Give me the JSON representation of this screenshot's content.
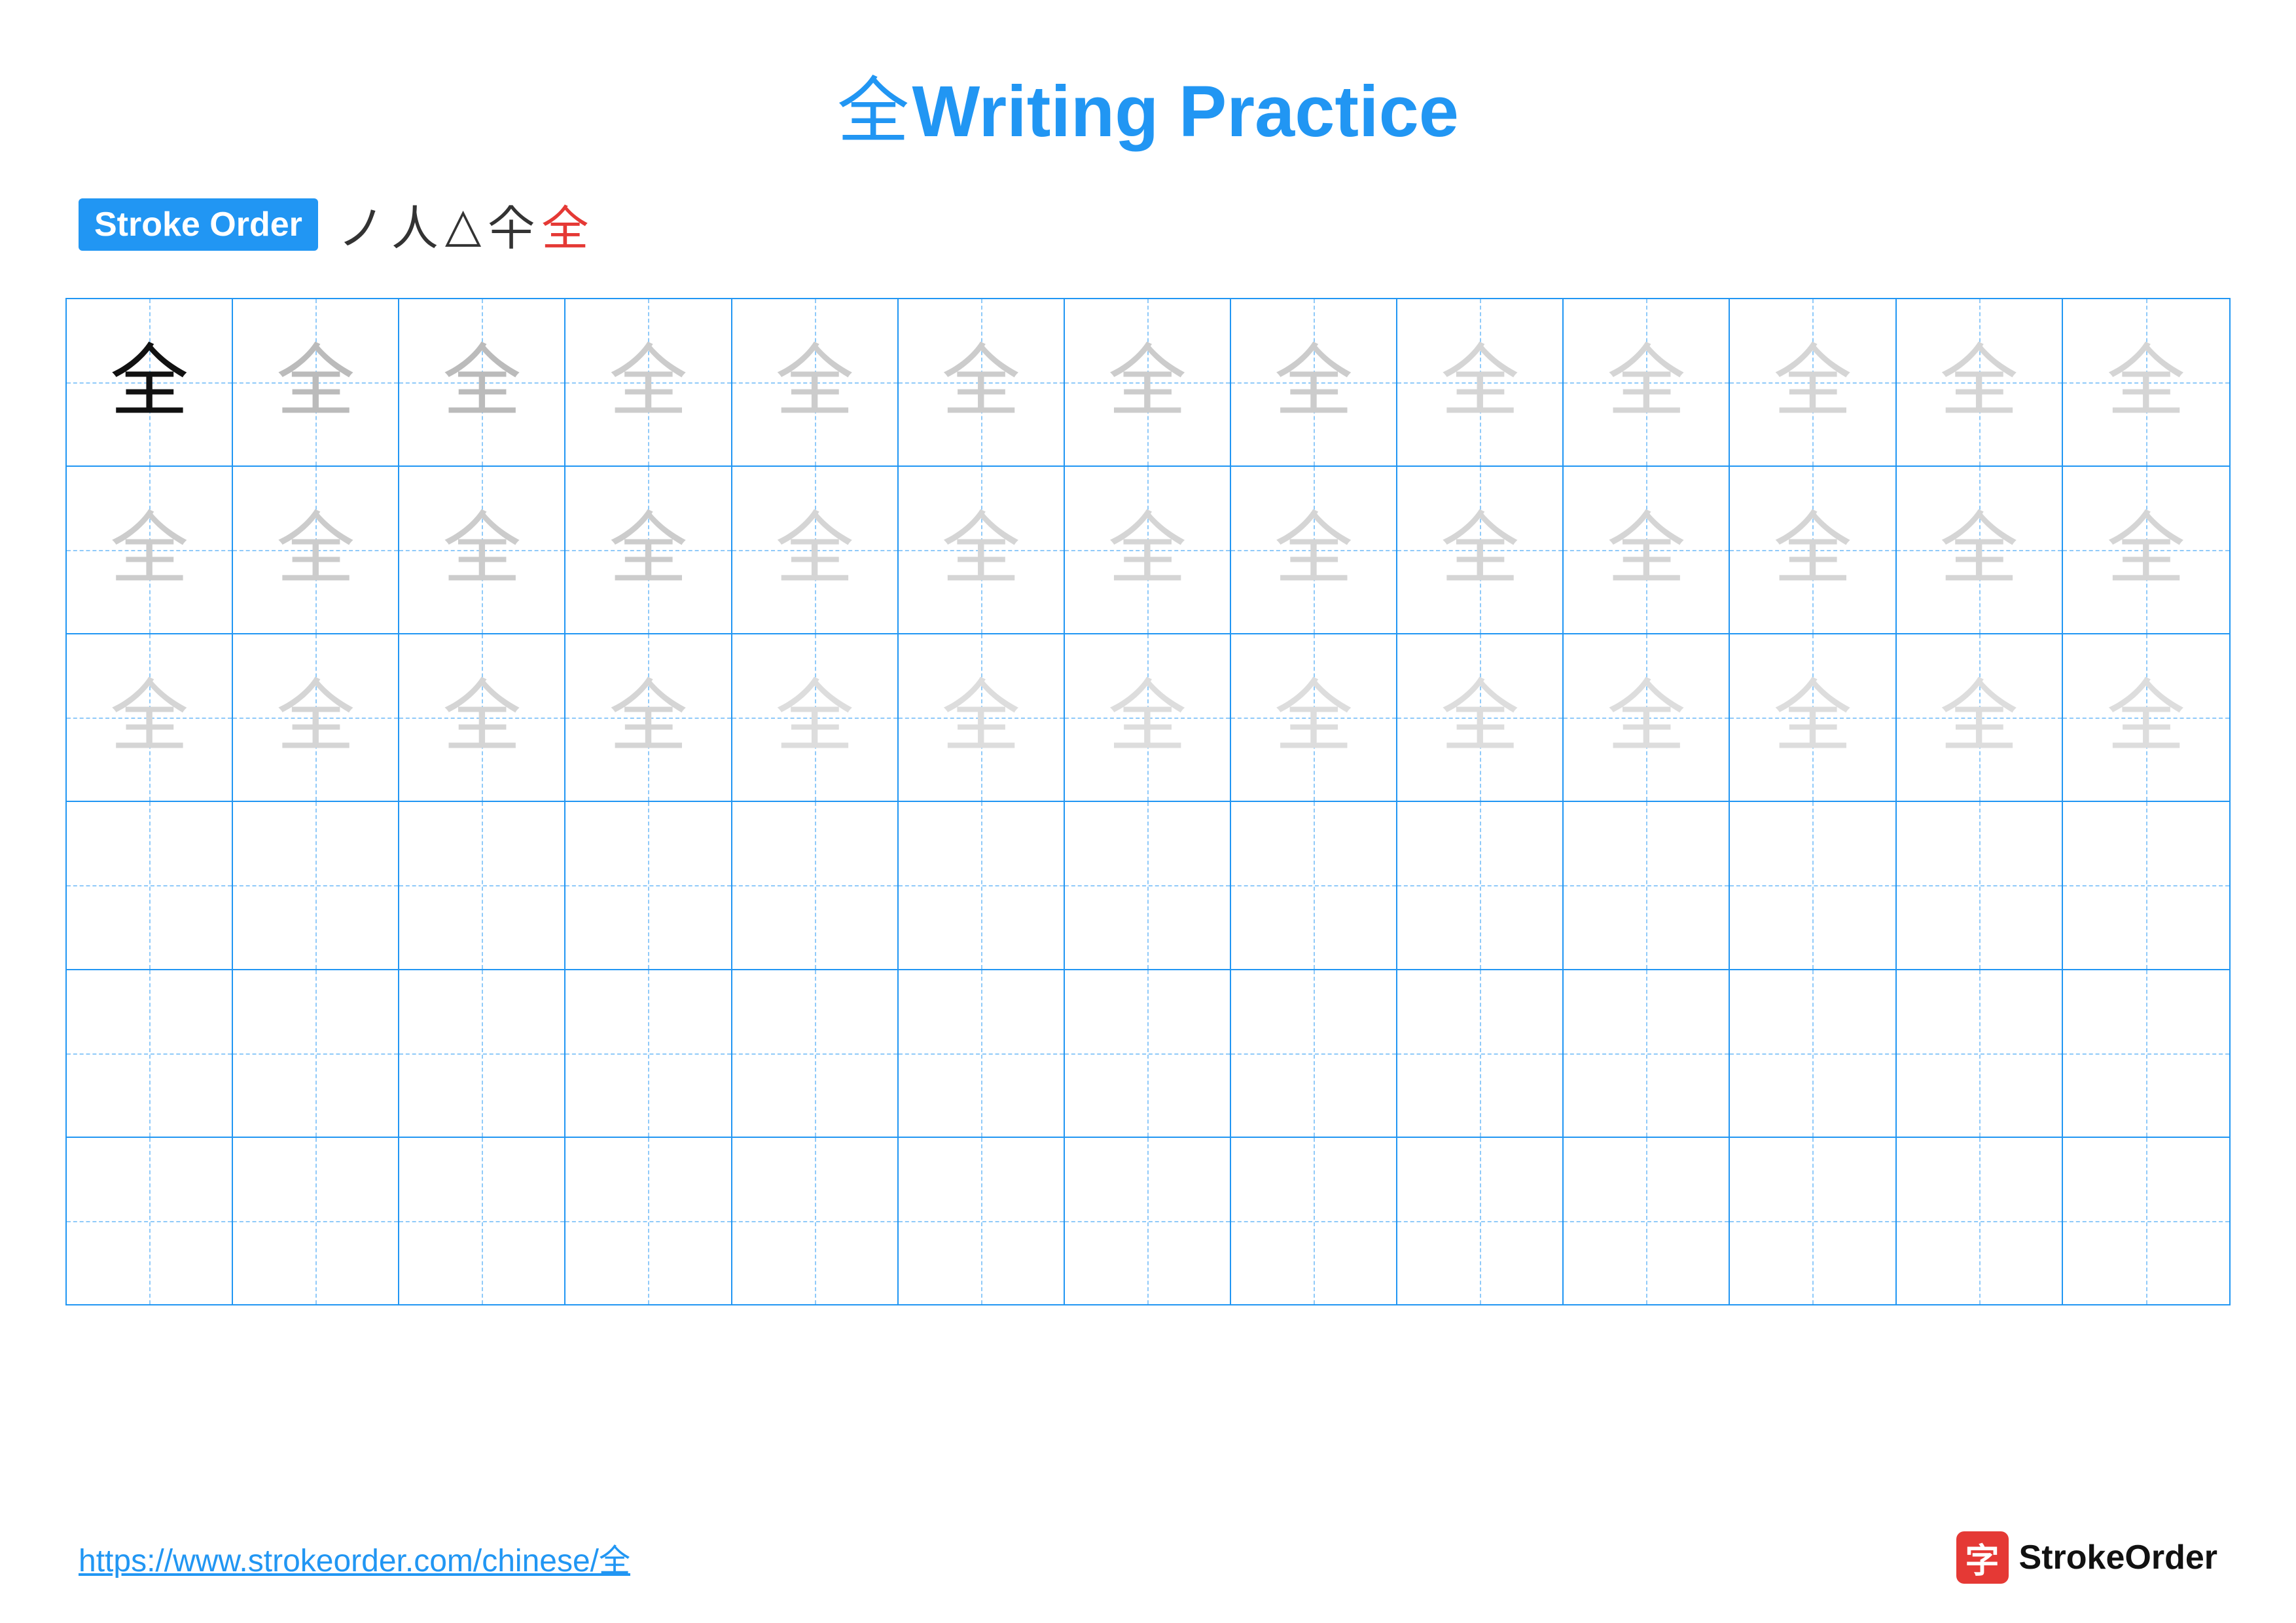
{
  "title": {
    "char": "全",
    "text": "Writing Practice"
  },
  "stroke_order": {
    "badge_label": "Stroke Order",
    "strokes": [
      "ノ",
      "人",
      "△",
      "仐",
      "全"
    ]
  },
  "grid": {
    "rows": 6,
    "cols": 13,
    "rows_data": [
      {
        "cells": [
          {
            "char": "全",
            "shade": "dark"
          },
          {
            "char": "全",
            "shade": "gray1"
          },
          {
            "char": "全",
            "shade": "gray1"
          },
          {
            "char": "全",
            "shade": "gray2"
          },
          {
            "char": "全",
            "shade": "gray2"
          },
          {
            "char": "全",
            "shade": "gray2"
          },
          {
            "char": "全",
            "shade": "gray2"
          },
          {
            "char": "全",
            "shade": "gray2"
          },
          {
            "char": "全",
            "shade": "gray3"
          },
          {
            "char": "全",
            "shade": "gray3"
          },
          {
            "char": "全",
            "shade": "gray3"
          },
          {
            "char": "全",
            "shade": "gray3"
          },
          {
            "char": "全",
            "shade": "gray3"
          }
        ]
      },
      {
        "cells": [
          {
            "char": "全",
            "shade": "gray2"
          },
          {
            "char": "全",
            "shade": "gray2"
          },
          {
            "char": "全",
            "shade": "gray2"
          },
          {
            "char": "全",
            "shade": "gray2"
          },
          {
            "char": "全",
            "shade": "gray3"
          },
          {
            "char": "全",
            "shade": "gray3"
          },
          {
            "char": "全",
            "shade": "gray3"
          },
          {
            "char": "全",
            "shade": "gray3"
          },
          {
            "char": "全",
            "shade": "gray3"
          },
          {
            "char": "全",
            "shade": "gray3"
          },
          {
            "char": "全",
            "shade": "gray3"
          },
          {
            "char": "全",
            "shade": "gray3"
          },
          {
            "char": "全",
            "shade": "gray3"
          }
        ]
      },
      {
        "cells": [
          {
            "char": "全",
            "shade": "gray3"
          },
          {
            "char": "全",
            "shade": "gray3"
          },
          {
            "char": "全",
            "shade": "gray3"
          },
          {
            "char": "全",
            "shade": "gray3"
          },
          {
            "char": "全",
            "shade": "gray3"
          },
          {
            "char": "全",
            "shade": "gray3"
          },
          {
            "char": "全",
            "shade": "gray3"
          },
          {
            "char": "全",
            "shade": "gray3"
          },
          {
            "char": "全",
            "shade": "gray3"
          },
          {
            "char": "全",
            "shade": "gray3"
          },
          {
            "char": "全",
            "shade": "gray3"
          },
          {
            "char": "全",
            "shade": "gray3"
          },
          {
            "char": "全",
            "shade": "gray3"
          }
        ]
      },
      {
        "empty": true
      },
      {
        "empty": true
      },
      {
        "empty": true
      }
    ]
  },
  "footer": {
    "url": "https://www.strokeorder.com/chinese/全",
    "logo_char": "字",
    "logo_text": "StrokeOrder"
  }
}
